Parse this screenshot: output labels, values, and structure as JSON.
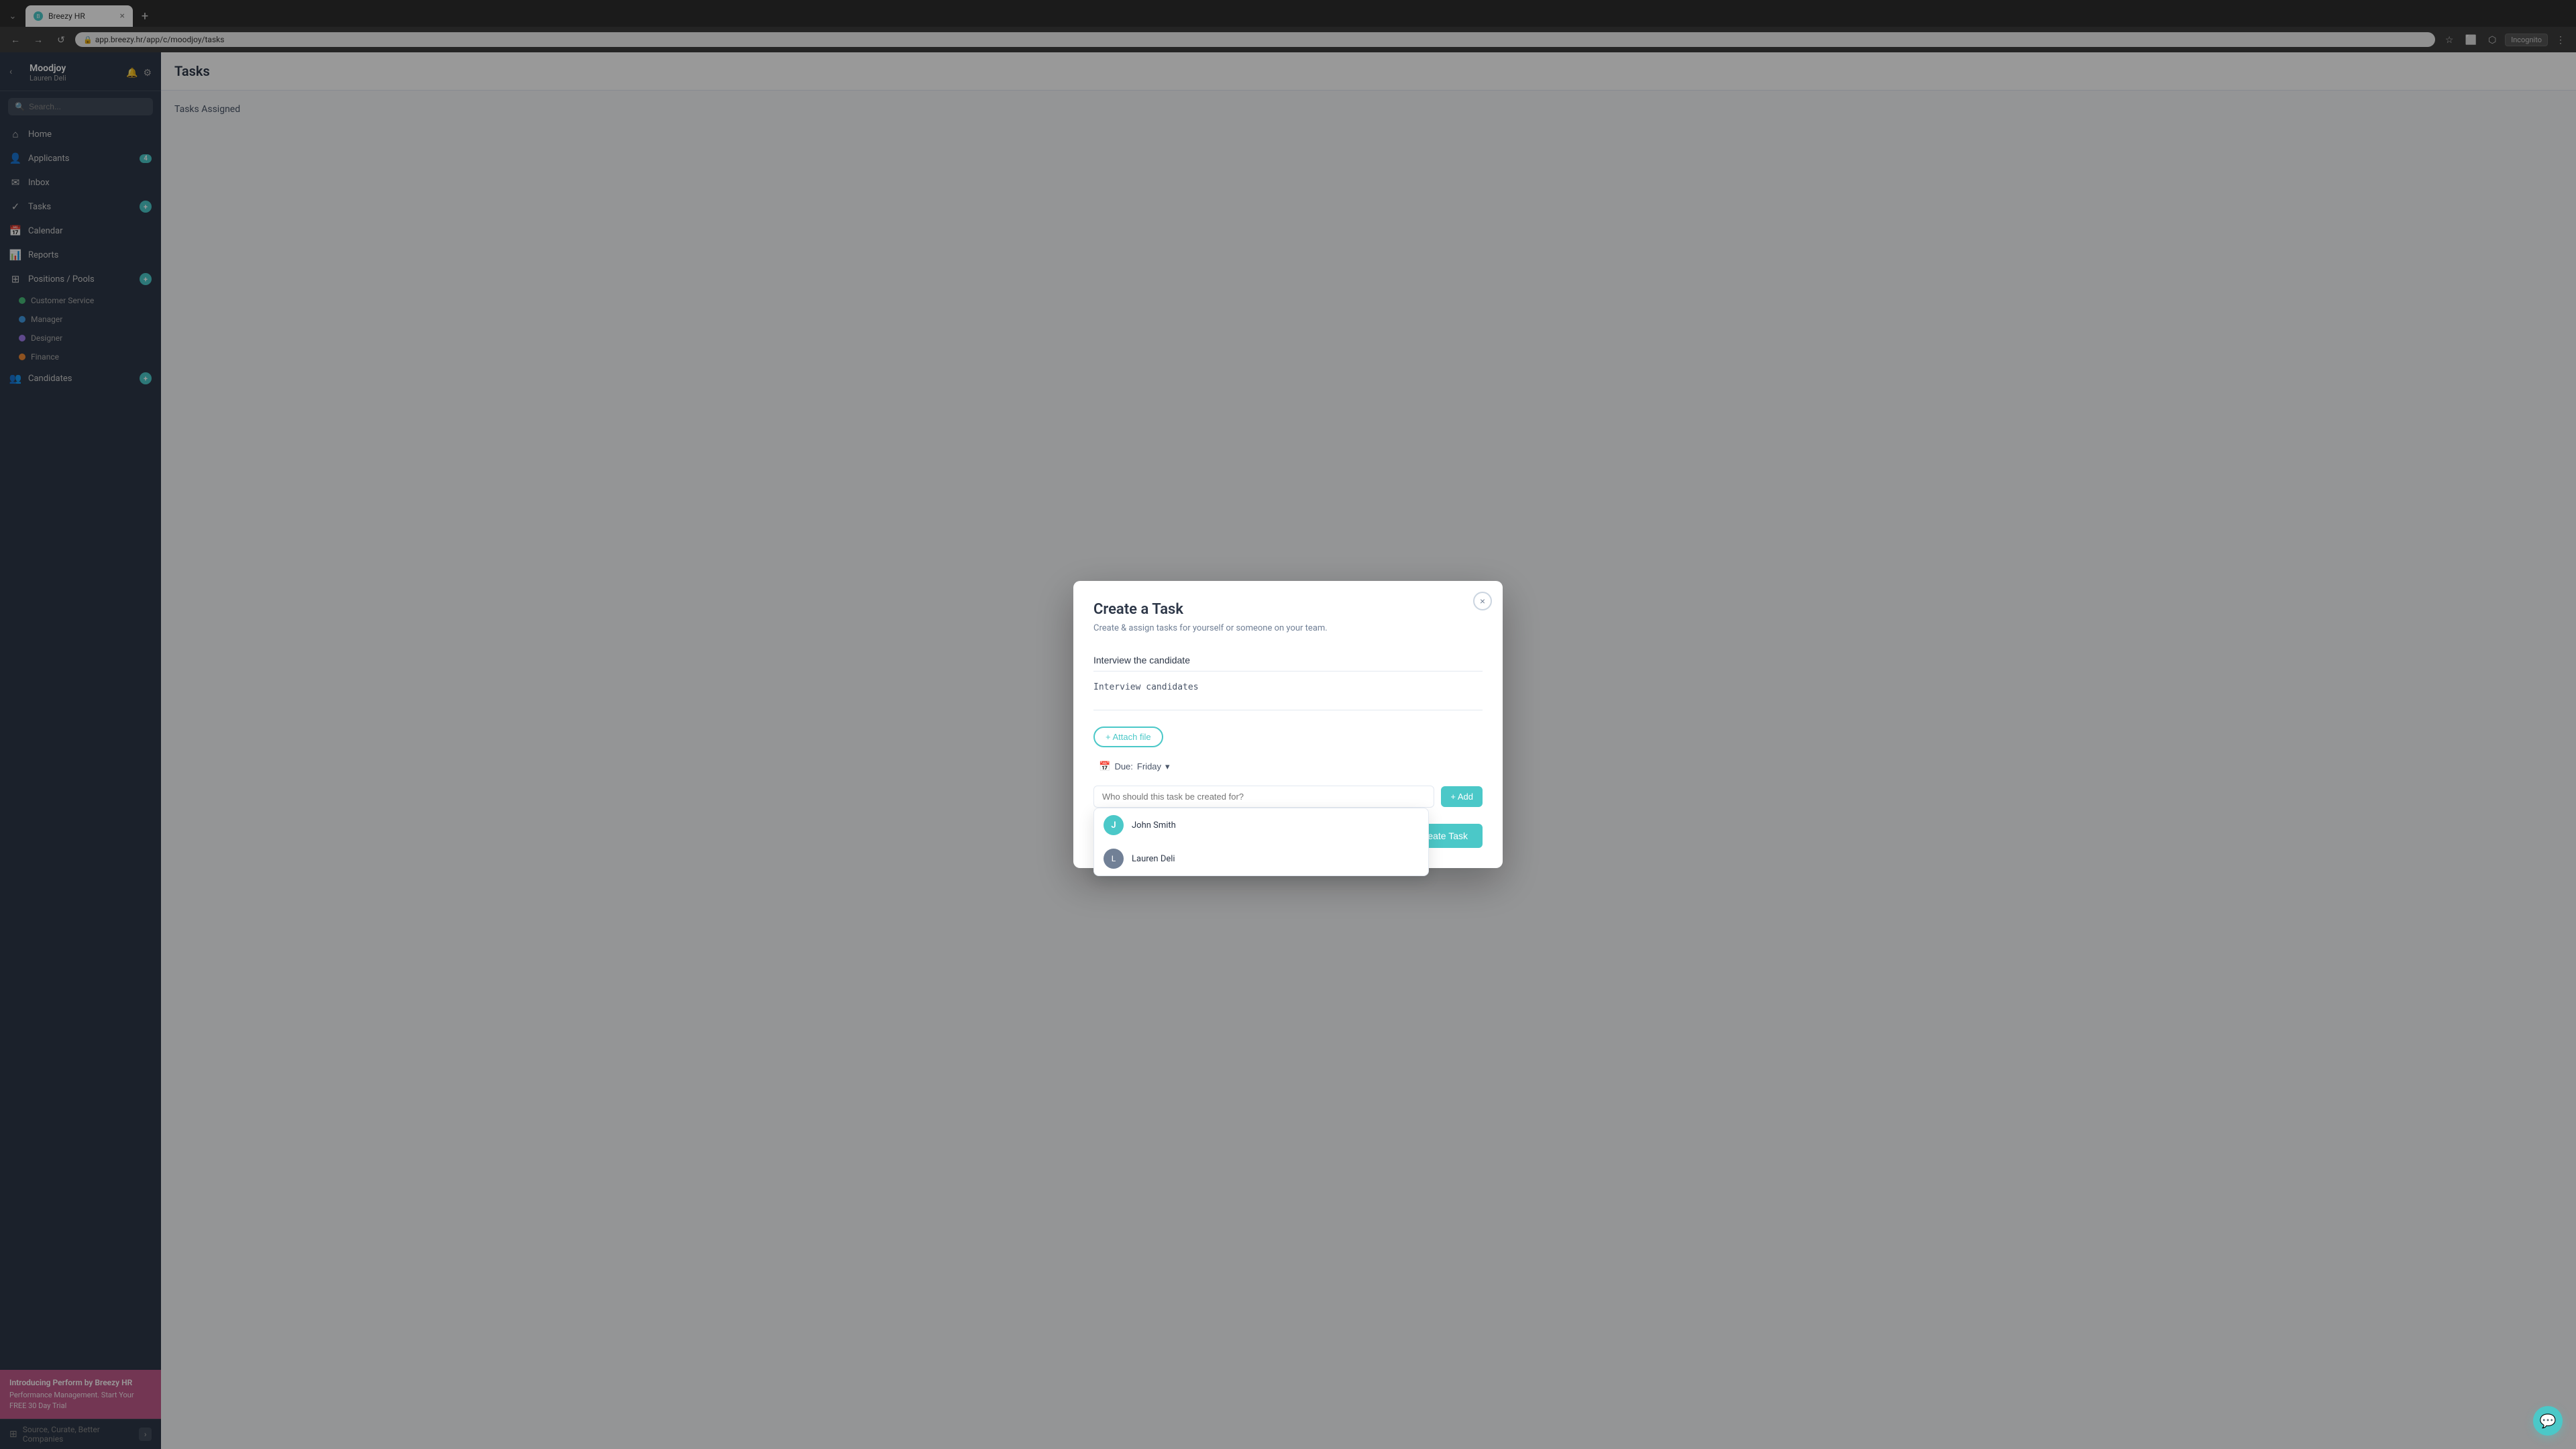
{
  "browser": {
    "tab_favicon": "B",
    "tab_title": "Breezy HR",
    "tab_close": "×",
    "new_tab": "+",
    "back": "←",
    "forward": "→",
    "reload": "↺",
    "address": "app.breezy.hr/app/c/moodjoy/tasks",
    "bookmark_icon": "☆",
    "extensions_icon": "⬜",
    "cast_icon": "⬡",
    "incognito_label": "Incognito",
    "menu_icon": "⋮"
  },
  "sidebar": {
    "back_icon": "‹",
    "company_name": "Moodjoy",
    "company_user": "Lauren Deli",
    "bell_icon": "🔔",
    "settings_icon": "⚙",
    "search_placeholder": "Search...",
    "nav_items": [
      {
        "id": "home",
        "icon": "⌂",
        "label": "Home",
        "badge": null
      },
      {
        "id": "applicants",
        "icon": "👤",
        "label": "Applicants",
        "badge": "4"
      },
      {
        "id": "inbox",
        "icon": "✉",
        "label": "Inbox",
        "badge": null
      },
      {
        "id": "tasks",
        "icon": "✓",
        "label": "Tasks",
        "badge_plus": true
      },
      {
        "id": "calendar",
        "icon": "📅",
        "label": "Calendar",
        "badge": null
      },
      {
        "id": "reports",
        "icon": "📊",
        "label": "Reports",
        "badge": null
      },
      {
        "id": "positions",
        "icon": "⊞",
        "label": "Positions / Pools",
        "badge_plus": true
      }
    ],
    "sub_items": [
      {
        "id": "customer-service",
        "color": "green",
        "label": "Customer Service"
      },
      {
        "id": "manager",
        "color": "blue",
        "label": "Manager"
      },
      {
        "id": "designer",
        "color": "purple",
        "label": "Designer"
      },
      {
        "id": "finance",
        "color": "orange",
        "label": "Finance"
      }
    ],
    "candidates": {
      "label": "Candidates",
      "icon": "👥",
      "badge_plus": true
    },
    "promo": {
      "title": "Introducing Perform by Breezy HR",
      "text": "Performance Management. Start Your FREE 30 Day Trial"
    },
    "footer": {
      "label": "Source, Curate, Better Companies",
      "collapse_icon": "›"
    }
  },
  "page": {
    "title": "Tasks",
    "tasks_assigned_label": "Tasks Assigned"
  },
  "modal": {
    "title": "Create a Task",
    "subtitle": "Create & assign tasks for yourself or someone on your team.",
    "close_icon": "×",
    "task_title_value": "Interview the candidate",
    "task_description_value": "Interview candidates",
    "attach_label": "+ Attach file",
    "due_label": "Due:",
    "due_value": "Friday",
    "due_dropdown_icon": "▾",
    "assign_placeholder": "Who should this task be created for?",
    "add_label": "+ Add",
    "assignees": [
      {
        "id": "john-smith",
        "initials": "J",
        "name": "John Smith",
        "color": "#4bc8c8"
      },
      {
        "id": "lauren-deli",
        "initials": "L",
        "name": "Lauren Deli",
        "color": "#718096"
      }
    ],
    "create_btn_icon": "⬛",
    "create_btn_label": "Create Task"
  },
  "chat": {
    "icon": "💬"
  }
}
